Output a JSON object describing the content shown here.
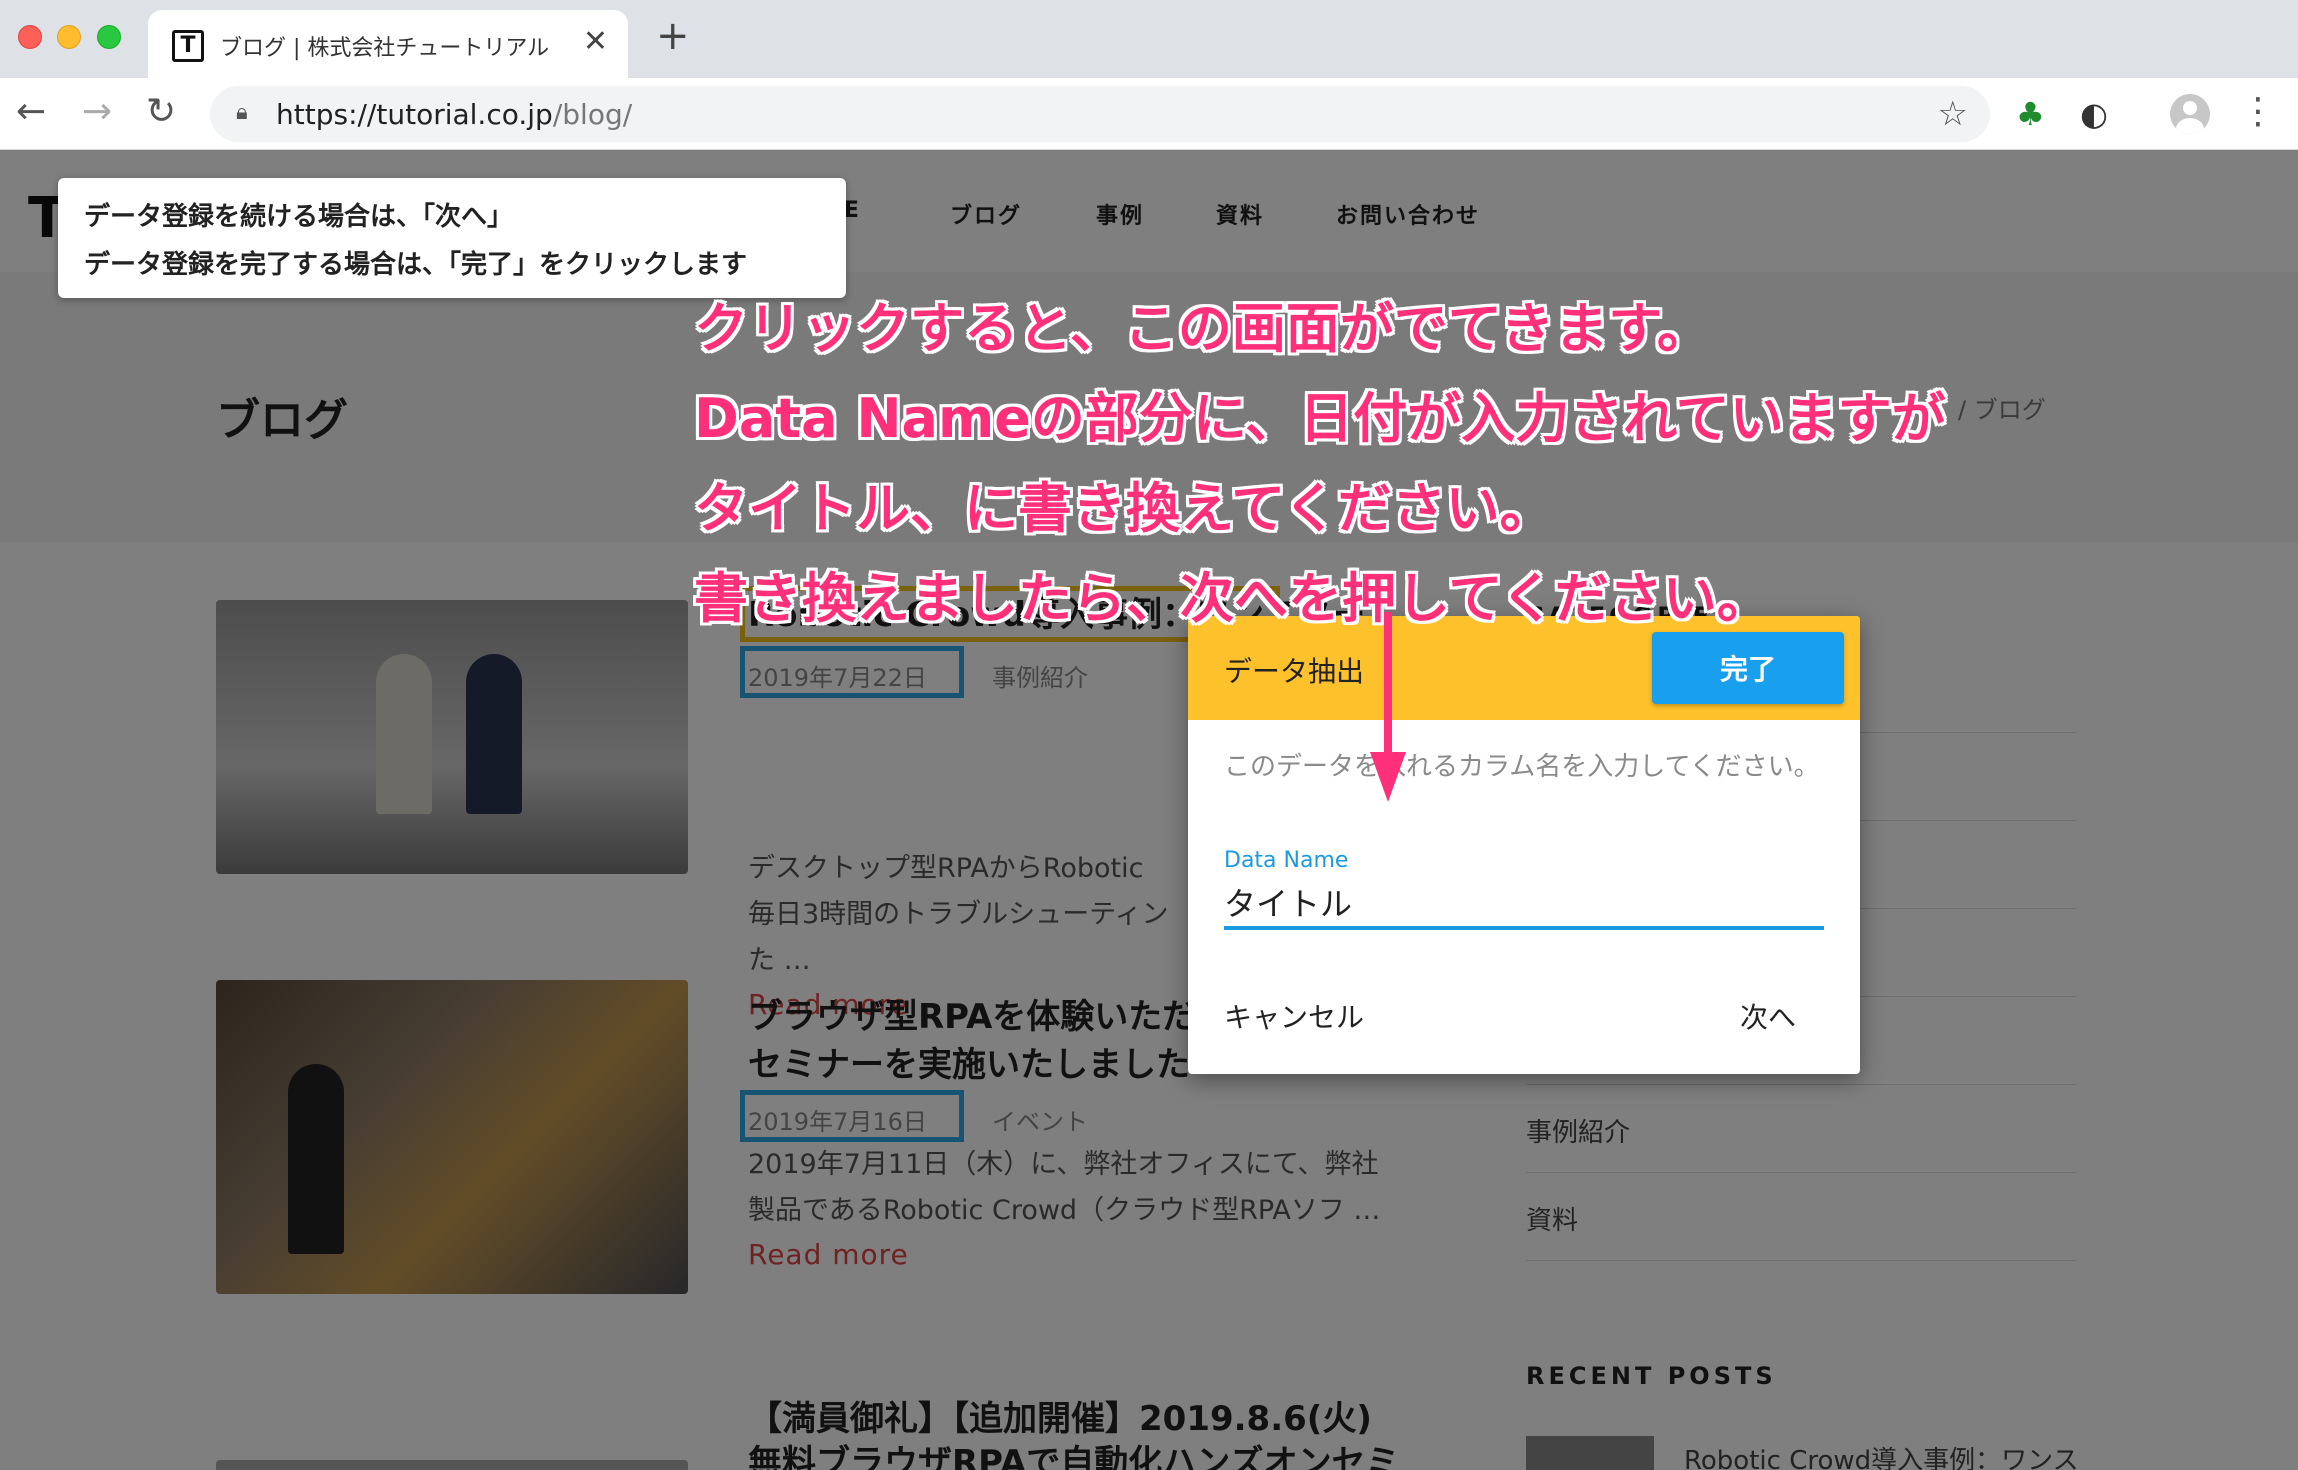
{
  "browser": {
    "tab_title": "ブログ | 株式会社チュートリアル",
    "tab_favicon": "T",
    "url_host": "https://tutorial.co.jp",
    "url_path": "/blog/"
  },
  "site": {
    "logo": "T",
    "nav": [
      "ME",
      "ブログ",
      "事例",
      "資料",
      "お問い合わせ"
    ],
    "page_title": "ブログ",
    "breadcrumb": "/ ブログ"
  },
  "posts": [
    {
      "title": "Robotic Crowd導入事例：ワンスター",
      "date": "2019年7月22日",
      "category": "事例紹介",
      "excerpt": [
        "デスクトップ型RPAからRobotic",
        "毎日3時間のトラブルシューティン",
        "た …"
      ],
      "read_more": "Read more"
    },
    {
      "title": [
        "ブラウザ型RPAを体験いただ",
        "セミナーを実施いたしました"
      ],
      "date": "2019年7月16日",
      "category": "イベント",
      "excerpt": [
        "2019年7月11日（木）に、弊社オフィスにて、弊社",
        "製品であるRobotic Crowd（クラウド型RPAソフ …"
      ],
      "read_more": "Read more"
    },
    {
      "title": [
        "【満員御礼】【追加開催】2019.8.6(火)",
        "無料ブラウザRPAで自動化ハンズオンセミ"
      ]
    }
  ],
  "sidebar": {
    "categories_heading": "CATEGORIES",
    "category_links": [
      "事例紹介",
      "資料"
    ],
    "recent_heading": "RECENT POSTS",
    "recent_first": "Robotic Crowd導入事例：ワンス"
  },
  "tooltip": {
    "line1": "データ登録を続ける場合は、「次へ」",
    "line2": "データ登録を完了する場合は、「完了」をクリックします"
  },
  "annotation": {
    "line1": "クリックすると、この画面がでてきます。",
    "line2": "Data Nameの部分に、日付が入力されていますが",
    "line3": "タイトル、に書き換えてください。",
    "line4": "書き換えましたら、次へを押してください。"
  },
  "dialog": {
    "title": "データ抽出",
    "done_label": "完了",
    "description": "このデータを入れるカラム名を入力してください。",
    "field_label": "Data Name",
    "field_value": "タイトル",
    "cancel_label": "キャンセル",
    "next_label": "次へ"
  },
  "colors": {
    "dialog_header": "#fdc12b",
    "done_button": "#18a0ef",
    "annotation_text": "#ff2f7a",
    "highlight_blue": "#2ea8e6",
    "highlight_yellow": "#f5c518"
  }
}
